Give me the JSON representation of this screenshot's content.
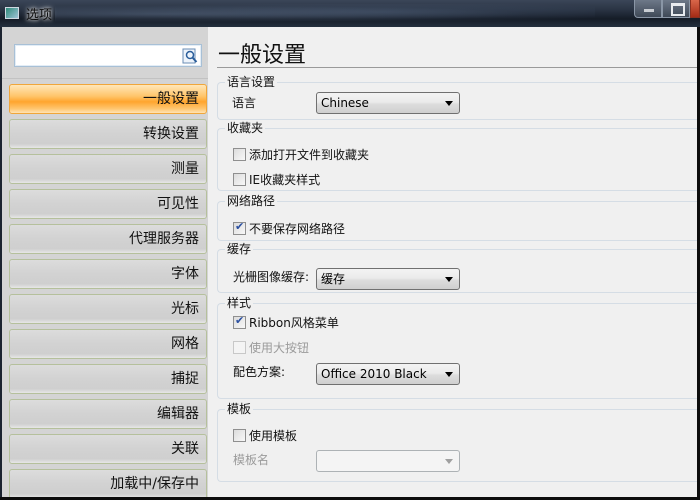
{
  "window": {
    "title": "选项",
    "controls": {
      "minimize": "minimize",
      "maximize": "maximize",
      "close": "close"
    }
  },
  "sidebar": {
    "search": {
      "value": "",
      "placeholder": ""
    },
    "items": [
      {
        "label": "一般设置",
        "active": true
      },
      {
        "label": "转换设置",
        "active": false
      },
      {
        "label": "测量",
        "active": false
      },
      {
        "label": "可见性",
        "active": false
      },
      {
        "label": "代理服务器",
        "active": false
      },
      {
        "label": "字体",
        "active": false
      },
      {
        "label": "光标",
        "active": false
      },
      {
        "label": "网格",
        "active": false
      },
      {
        "label": "捕捉",
        "active": false
      },
      {
        "label": "编辑器",
        "active": false
      },
      {
        "label": "关联",
        "active": false
      },
      {
        "label": "加载中/保存中",
        "active": false
      }
    ]
  },
  "main": {
    "title": "一般设置",
    "groups": {
      "language": {
        "label": "语言设置",
        "field_label": "语言",
        "value": "Chinese"
      },
      "favorites": {
        "label": "收藏夹",
        "options": [
          {
            "label": "添加打开文件到收藏夹",
            "checked": false
          },
          {
            "label": "IE收藏夹样式",
            "checked": false
          }
        ]
      },
      "network": {
        "label": "网络路径",
        "options": [
          {
            "label": "不要保存网络路径",
            "checked": true
          }
        ]
      },
      "cache": {
        "label": "缓存",
        "field_label": "光栅图像缓存:",
        "value": "缓存"
      },
      "style": {
        "label": "样式",
        "options": [
          {
            "label": "Ribbon风格菜单",
            "checked": true,
            "enabled": true
          },
          {
            "label": "使用大按钮",
            "checked": false,
            "enabled": false
          }
        ],
        "scheme_label": "配色方案:",
        "scheme_value": "Office 2010 Black"
      },
      "template": {
        "label": "模板",
        "options": [
          {
            "label": "使用模板",
            "checked": false
          }
        ],
        "name_label": "模板名",
        "name_value": ""
      }
    }
  }
}
